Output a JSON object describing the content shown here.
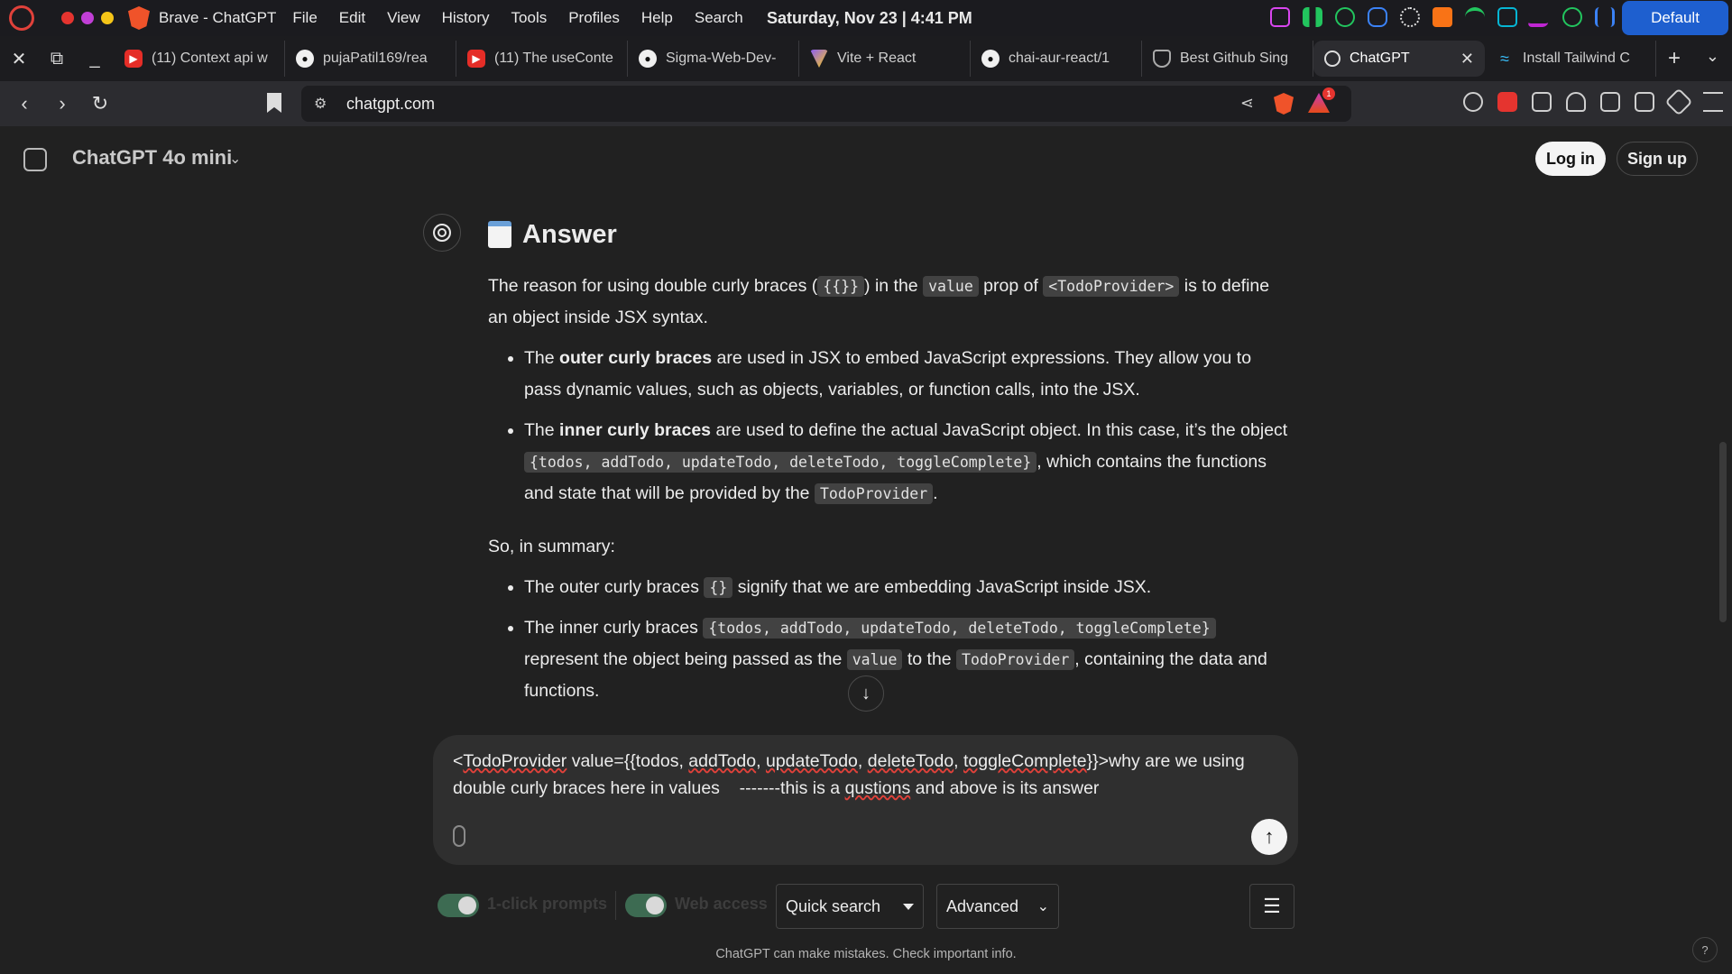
{
  "system": {
    "app_title": "Brave - ChatGPT",
    "menu": [
      "File",
      "Edit",
      "View",
      "History",
      "Tools",
      "Profiles",
      "Help",
      "Search"
    ],
    "clock": "Saturday, Nov 23 | 4:41 PM",
    "profile_button": "Default",
    "window_dot_colors": [
      "#e5342f",
      "#c13fd6",
      "#f5c518"
    ]
  },
  "tabs": [
    {
      "label": "(11) Context api w",
      "icon": "youtube-icon",
      "active": false
    },
    {
      "label": "pujaPatil169/rea",
      "icon": "github-icon",
      "active": false
    },
    {
      "label": "(11) The useConte",
      "icon": "youtube-icon",
      "active": false
    },
    {
      "label": "Sigma-Web-Dev-",
      "icon": "github-icon",
      "active": false
    },
    {
      "label": "Vite + React",
      "icon": "vite-icon",
      "active": false
    },
    {
      "label": "chai-aur-react/1",
      "icon": "github-icon",
      "active": false
    },
    {
      "label": "Best Github Sing",
      "icon": "shield-icon",
      "active": false
    },
    {
      "label": "ChatGPT",
      "icon": "chatgpt-icon",
      "active": true
    },
    {
      "label": "Install Tailwind C",
      "icon": "tailwind-icon",
      "active": false
    }
  ],
  "address_bar": {
    "url": "chatgpt.com",
    "rewards_badge": "1"
  },
  "chat_header": {
    "model": "ChatGPT 4o mini",
    "login": "Log in",
    "signup": "Sign up"
  },
  "answer": {
    "heading": "Answer",
    "intro": {
      "t1": "The reason for using double curly braces (",
      "c1": "{{}}",
      "t2": ") in the ",
      "c2": "value",
      "t3": " prop of ",
      "c3": "<TodoProvider>",
      "t4": " is to define an object inside JSX syntax."
    },
    "bullets": [
      {
        "t1": "The ",
        "b1": "outer curly braces",
        "t2": " are used in JSX to embed JavaScript expressions. They allow you to pass dynamic values, such as objects, variables, or function calls, into the JSX."
      },
      {
        "t1": "The ",
        "b1": "inner curly braces",
        "t2": " are used to define the actual JavaScript object. In this case, it’s the object ",
        "c1": "{todos, addTodo, updateTodo, deleteTodo, toggleComplete}",
        "t3": ", which contains the functions and state that will be provided by the ",
        "c2": "TodoProvider",
        "t4": "."
      }
    ],
    "summary_label": "So, in summary:",
    "summary": [
      {
        "t1": "The outer curly braces ",
        "c1": "{}",
        "t2": " signify that we are embedding JavaScript inside JSX."
      },
      {
        "t1": "The inner curly braces ",
        "c1": "{todos, addTodo, updateTodo, deleteTodo, toggleComplete}",
        "t2": " represent the object being passed as the ",
        "c2": "value",
        "t3": " to the ",
        "c3": "TodoProvider",
        "t4": ", containing the data and functions."
      }
    ]
  },
  "composer": {
    "p1": "<",
    "w1": "TodoProvider",
    "p2": " value={{todos, ",
    "w2": "addTodo",
    "p3": ", ",
    "w3": "updateTodo",
    "p4": ", ",
    "w4": "deleteTodo",
    "p5": ", ",
    "w5": "toggleComplete",
    "p6": "}}>why are we using double curly braces here in values    -------this is a ",
    "w6": "qustions",
    "p7": " and above is its answer"
  },
  "extension_bar": {
    "toggle1_label": "1-click prompts",
    "toggle1_on": true,
    "toggle2_label": "Web access",
    "toggle2_on": true,
    "search_mode": "Quick search",
    "mode": "Advanced"
  },
  "footer": {
    "disclaimer": "ChatGPT can make mistakes. Check important info.",
    "help": "?"
  }
}
